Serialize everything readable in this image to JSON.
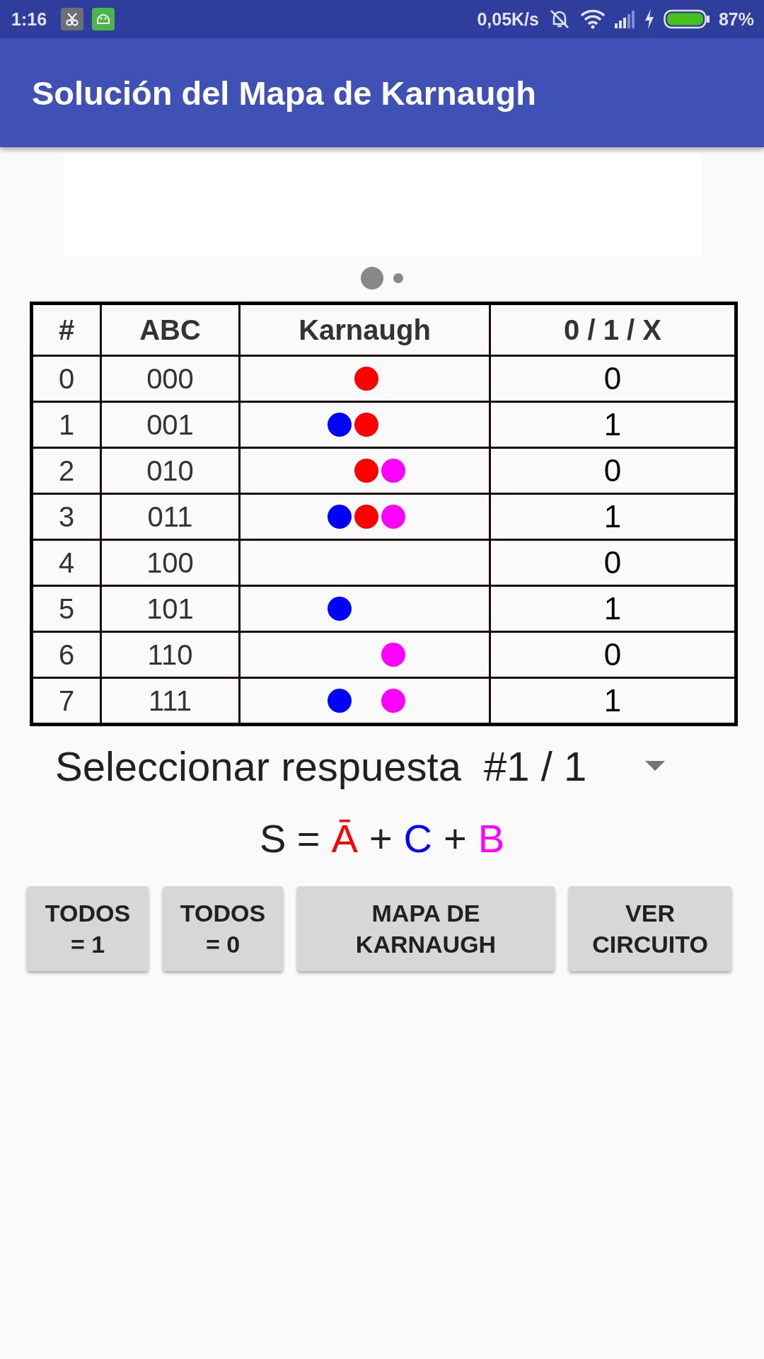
{
  "status_bar": {
    "time": "1:16",
    "net_speed": "0,05K/s",
    "battery": "87%"
  },
  "app_bar": {
    "title": "Solución del Mapa de Karnaugh"
  },
  "carousel": {
    "pages": [
      {
        "selected": true
      },
      {
        "selected": false
      }
    ]
  },
  "table": {
    "columns": [
      "#",
      "ABC",
      "Karnaugh",
      "0 / 1 / X"
    ],
    "rows": [
      {
        "index": "0",
        "abc": "000",
        "dots": [
          {
            "on": false
          },
          {
            "on": true,
            "color": "#ff0000"
          },
          {
            "on": false
          }
        ],
        "value": "0"
      },
      {
        "index": "1",
        "abc": "001",
        "dots": [
          {
            "on": true,
            "color": "#0000ff"
          },
          {
            "on": true,
            "color": "#ff0000"
          },
          {
            "on": false
          }
        ],
        "value": "1"
      },
      {
        "index": "2",
        "abc": "010",
        "dots": [
          {
            "on": false
          },
          {
            "on": true,
            "color": "#ff0000"
          },
          {
            "on": true,
            "color": "#ff00ff"
          }
        ],
        "value": "0"
      },
      {
        "index": "3",
        "abc": "011",
        "dots": [
          {
            "on": true,
            "color": "#0000ff"
          },
          {
            "on": true,
            "color": "#ff0000"
          },
          {
            "on": true,
            "color": "#ff00ff"
          }
        ],
        "value": "1"
      },
      {
        "index": "4",
        "abc": "100",
        "dots": [
          {
            "on": false
          },
          {
            "on": false
          },
          {
            "on": false
          }
        ],
        "value": "0"
      },
      {
        "index": "5",
        "abc": "101",
        "dots": [
          {
            "on": true,
            "color": "#0000ff"
          },
          {
            "on": false
          },
          {
            "on": false
          }
        ],
        "value": "1"
      },
      {
        "index": "6",
        "abc": "110",
        "dots": [
          {
            "on": false
          },
          {
            "on": false
          },
          {
            "on": true,
            "color": "#ff00ff"
          }
        ],
        "value": "0"
      },
      {
        "index": "7",
        "abc": "111",
        "dots": [
          {
            "on": true,
            "color": "#0000ff"
          },
          {
            "on": false
          },
          {
            "on": true,
            "color": "#ff00ff"
          }
        ],
        "value": "1"
      }
    ]
  },
  "answer_select": {
    "value": "Seleccionar respuesta  #1 / 1"
  },
  "formula": [
    {
      "text": "S =",
      "color": "#212121"
    },
    {
      "text": "Ā",
      "color": "#ff0000"
    },
    {
      "text": "+",
      "color": "#212121"
    },
    {
      "text": "C",
      "color": "#0000ff"
    },
    {
      "text": "+",
      "color": "#212121"
    },
    {
      "text": "B",
      "color": "#ff00ff"
    }
  ],
  "buttons": [
    {
      "label": "TODOS\n= 1"
    },
    {
      "label": "TODOS\n= 0"
    },
    {
      "label": "MAPA DE\nKARNAUGH"
    },
    {
      "label": "VER\nCIRCUITO"
    }
  ]
}
